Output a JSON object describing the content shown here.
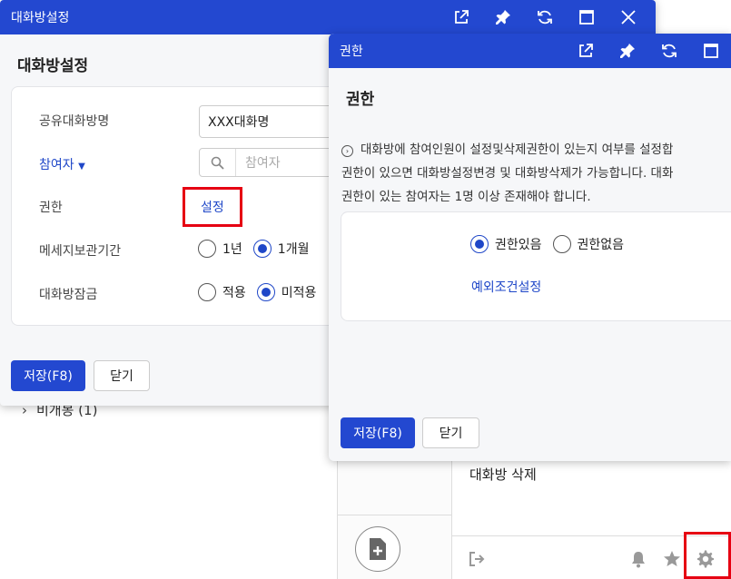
{
  "background": {
    "tree_item": "비개봉 (1)",
    "delete_room": "대화방 삭제"
  },
  "settings_window": {
    "title": "대화방설정",
    "heading": "대화방설정",
    "fields": {
      "shared_name_label": "공유대화방명",
      "shared_name_value": "XXX대화명",
      "participants_label": "참여자",
      "search_placeholder": "참여자",
      "permission_label": "권한",
      "permission_link": "설정",
      "retention_label": "메세지보관기간",
      "retention_options": [
        "1년",
        "1개월"
      ],
      "retention_selected": "1개월",
      "lock_label": "대화방잠금",
      "lock_options": [
        "적용",
        "미적용"
      ],
      "lock_selected": "미적용"
    },
    "save_label": "저장(F8)",
    "close_label": "닫기"
  },
  "permission_window": {
    "title": "권한",
    "heading": "권한",
    "description_lines": [
      "대화방에 참여인원이 설정및삭제권한이 있는지 여부를 설정합",
      "권한이 있으면 대화방설정변경 및 대화방삭제가 가능합니다. 대화",
      "권한이 있는 참여자는 1명 이상 존재해야 합니다."
    ],
    "options": [
      "권한있음",
      "권한없음"
    ],
    "selected": "권한있음",
    "exception_link": "예외조건설정",
    "save_label": "저장(F8)",
    "close_label": "닫기"
  },
  "colors": {
    "titlebar": "#2348d0",
    "accent": "#1f47c8",
    "highlight": "#e60012"
  }
}
